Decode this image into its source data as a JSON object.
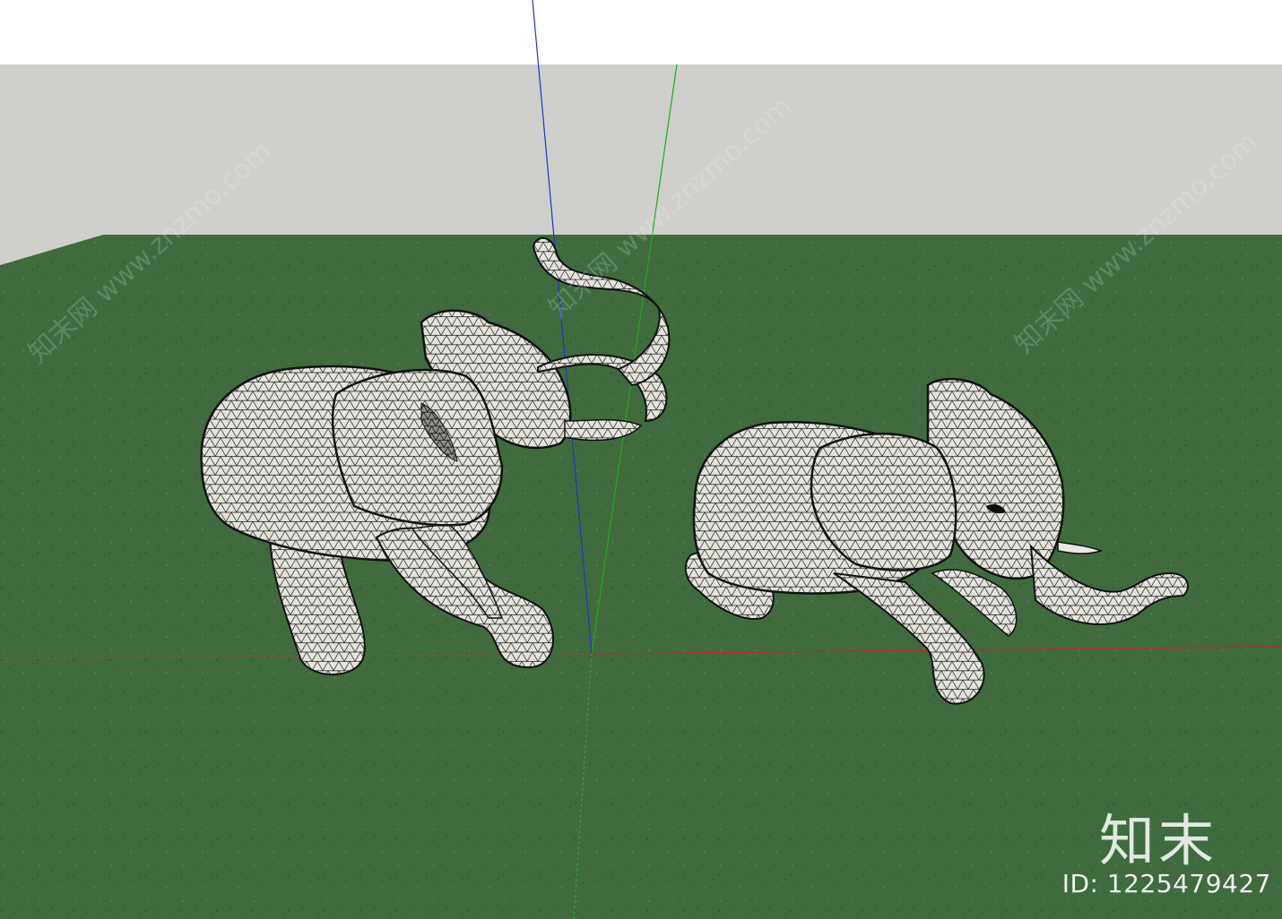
{
  "scene": {
    "sky_color": "#ffffff",
    "wall_color": "#cfd0cb",
    "ground_color": "#3f6b3f",
    "axis_colors": {
      "x": "#cc2222",
      "y": "#22aa22",
      "z": "#2233cc"
    },
    "objects": [
      "elephant-standing-trunk-up",
      "elephant-lying-down"
    ]
  },
  "watermark": {
    "logo_text": "知末",
    "id_text": "ID: 1225479427",
    "diagonal_text": "知末网 www.znzmo.com"
  }
}
